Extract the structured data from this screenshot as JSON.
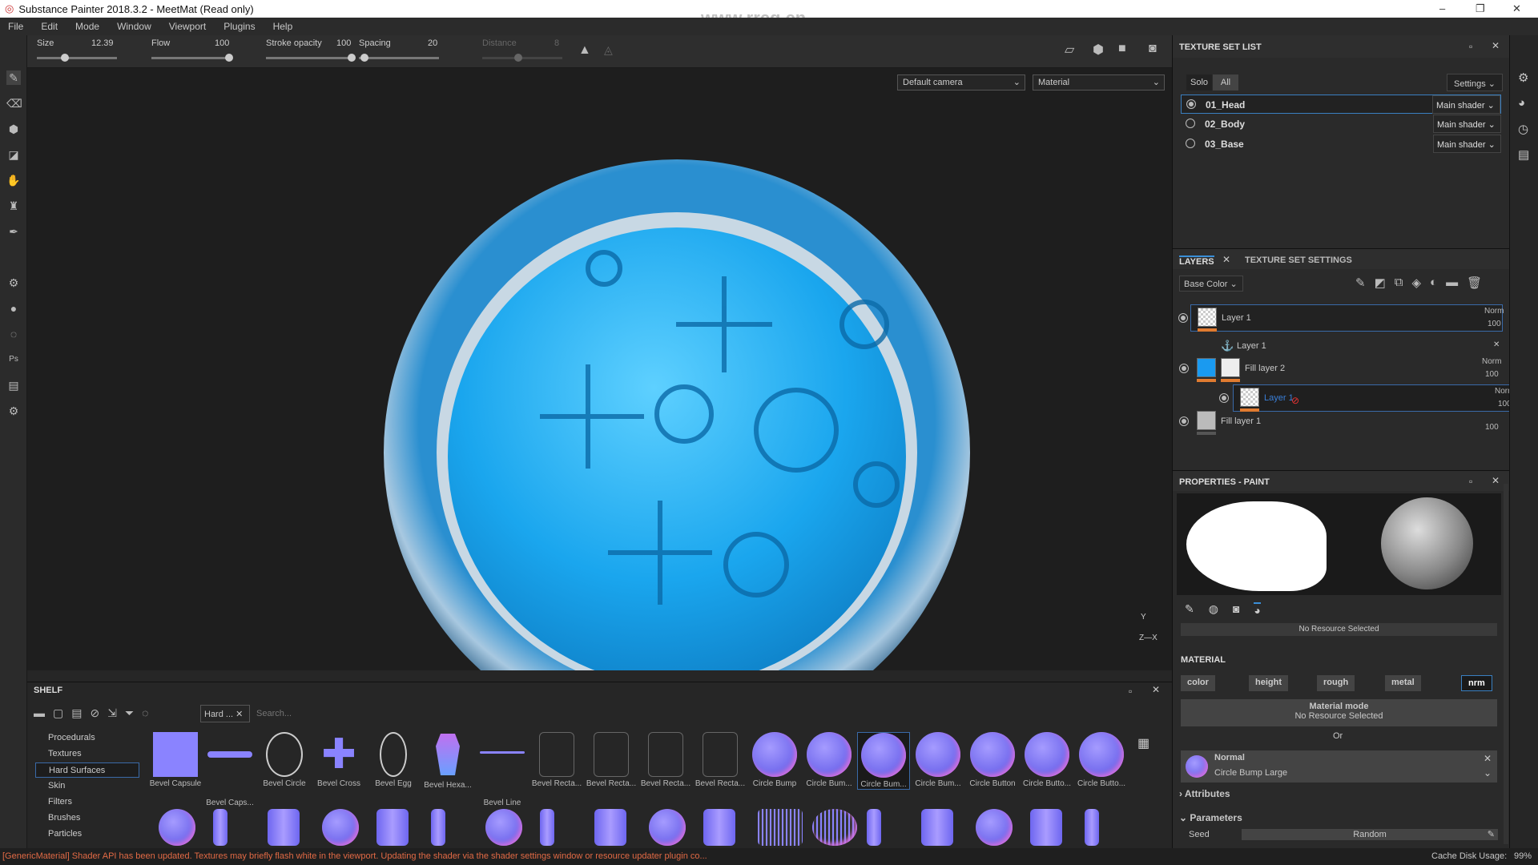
{
  "window": {
    "title": "Substance Painter 2018.3.2 - MeetMat (Read only)",
    "controls": [
      "–",
      "❐",
      "✕"
    ]
  },
  "menu": [
    "File",
    "Edit",
    "Mode",
    "Window",
    "Viewport",
    "Plugins",
    "Help"
  ],
  "tool_options": {
    "size_label": "Size",
    "size_value": "12.39",
    "flow_label": "Flow",
    "flow_value": "100",
    "opacity_label": "Stroke opacity",
    "opacity_value": "100",
    "spacing_label": "Spacing",
    "spacing_value": "20",
    "distance_label": "Distance",
    "distance_value": "8"
  },
  "viewport": {
    "camera": "Default camera",
    "mode": "Material",
    "axis_y": "Y",
    "axis_x": "Z—X",
    "object_color": "#1ea8f0"
  },
  "texture_set_list": {
    "title": "TEXTURE SET LIST",
    "solo": "Solo",
    "all": "All",
    "settings": "Settings",
    "sets": [
      {
        "name": "01_Head",
        "shader": "Main shader",
        "selected": true
      },
      {
        "name": "02_Body",
        "shader": "Main shader",
        "selected": false
      },
      {
        "name": "03_Base",
        "shader": "Main shader",
        "selected": false
      }
    ]
  },
  "layers": {
    "tab": "LAYERS",
    "tab2": "TEXTURE SET SETTINGS",
    "channel": "Base Color",
    "items": [
      {
        "name": "Layer 1",
        "blend": "Norm",
        "opacity": "100"
      },
      {
        "name": "Layer 1",
        "anchor": true
      },
      {
        "name": "Fill layer 2",
        "blend": "Norm",
        "opacity": "100"
      },
      {
        "name": "Layer 1",
        "blend": "Norm",
        "opacity": "100",
        "dragging": true
      },
      {
        "name": "Fill layer 1",
        "opacity": "100"
      }
    ]
  },
  "properties": {
    "title": "PROPERTIES - PAINT",
    "no_resource": "No Resource Selected",
    "material_label": "MATERIAL",
    "channels": [
      "color",
      "height",
      "rough",
      "metal",
      "nrm"
    ],
    "active_channel": "nrm",
    "material_mode": "Material mode",
    "material_mode_value": "No Resource Selected",
    "or": "Or",
    "normal_label": "Normal",
    "normal_value": "Circle Bump Large",
    "attributes": "Attributes",
    "parameters": "Parameters",
    "seed_label": "Seed",
    "seed_value": "Random"
  },
  "shelf": {
    "title": "SHELF",
    "filter_tag": "Hard ...",
    "search_placeholder": "Search...",
    "categories": [
      "Procedurals",
      "Textures",
      "Hard Surfaces",
      "Skin",
      "Filters",
      "Brushes",
      "Particles"
    ],
    "active_category": "Hard Surfaces",
    "items": [
      "Bevel Capsule",
      "Bevel Caps...",
      "Bevel Circle",
      "Bevel Cross",
      "Bevel Egg",
      "Bevel Hexa...",
      "Bevel Line",
      "Bevel Recta...",
      "Bevel Recta...",
      "Bevel Recta...",
      "Bevel Recta...",
      "Circle Bump",
      "Circle Bum...",
      "Circle Bum...",
      "Circle Bum...",
      "Circle Button",
      "Circle Butto...",
      "Circle Butto..."
    ],
    "selected_item": "Circle Bum..."
  },
  "status": {
    "message": "[GenericMaterial] Shader API has been updated. Textures may briefly flash white in the viewport. Updating the shader via the shader settings window or resource updater plugin co...",
    "cache": "Cache Disk Usage:",
    "cache_value": "99%"
  },
  "watermark": "www.rrcg.cn"
}
